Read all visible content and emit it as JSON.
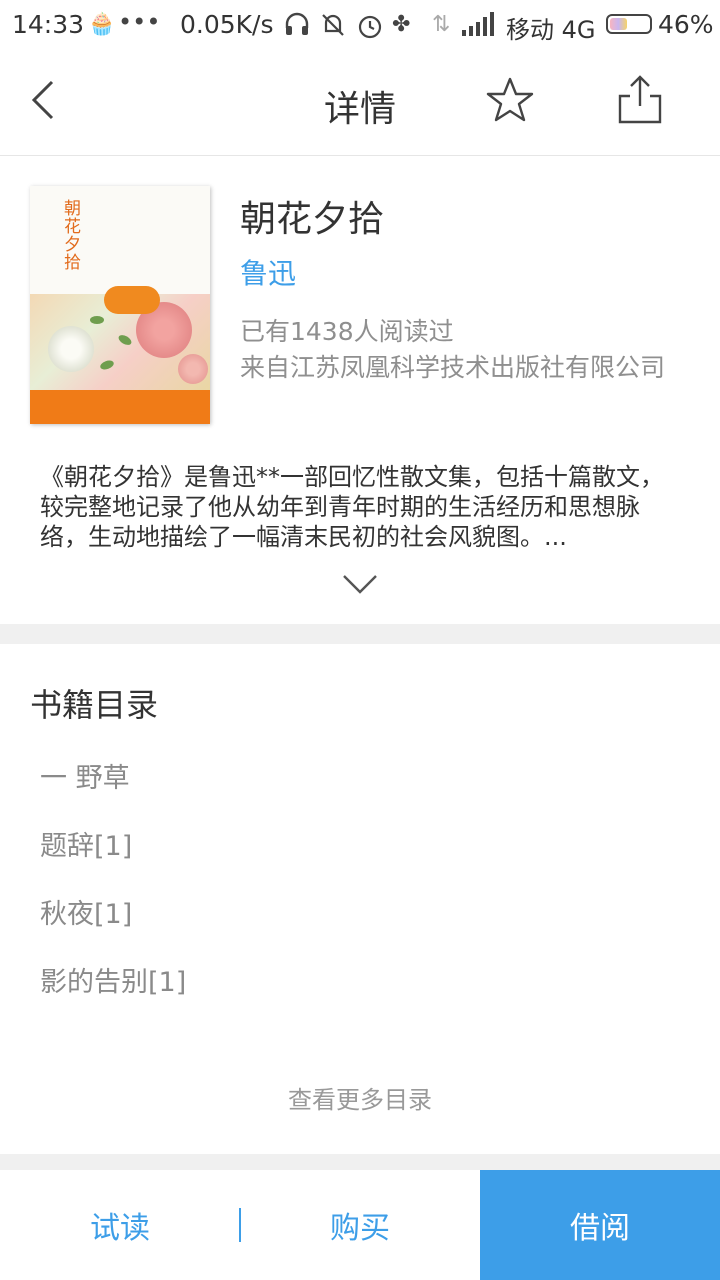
{
  "status_bar": {
    "time": "14:33",
    "dots": "•••",
    "speed": "0.05K/s",
    "carrier": "移动 4G",
    "battery": "46%",
    "battery_level": 0.46
  },
  "header": {
    "title": "详情",
    "back_icon": "chevron-left-icon",
    "star_icon": "star-outline-icon",
    "share_icon": "share-icon"
  },
  "book": {
    "cover_title": "朝花夕拾",
    "title": "朝花夕拾",
    "author": "鲁迅",
    "readers": "已有1438人阅读过",
    "publisher": "来自江苏凤凰科学技术出版社有限公司",
    "summary": "《朝花夕拾》是鲁迅**一部回忆性散文集，包括十篇散文，较完整地记录了他从幼年到青年时期的生活经历和思想脉络，生动地描绘了一幅清末民初的社会风貌图。..."
  },
  "toc": {
    "title": "书籍目录",
    "items": [
      "一 野草",
      "题辞[1]",
      "秋夜[1]",
      "影的告别[1]"
    ],
    "more": "查看更多目录"
  },
  "bottom_bar": {
    "trial": "试读",
    "buy": "购买",
    "borrow": "借阅"
  },
  "colors": {
    "accent": "#3d9ee8",
    "text": "#333333",
    "muted": "#8f8f8f",
    "divider": "#f0f0f0"
  }
}
